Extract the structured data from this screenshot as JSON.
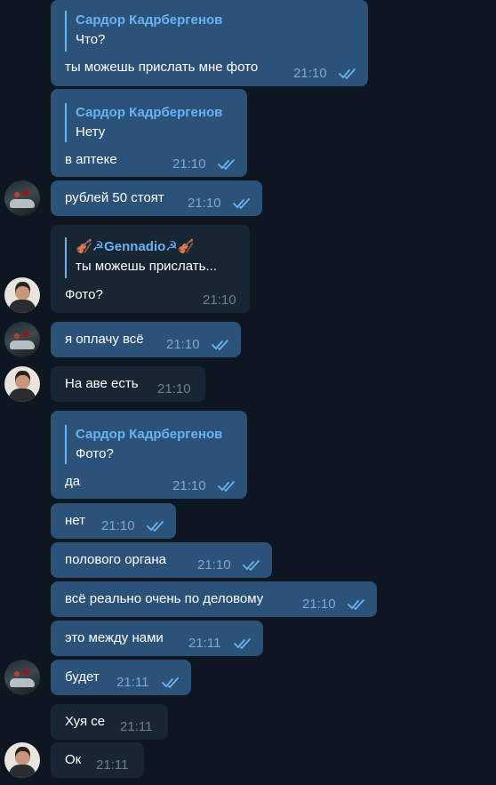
{
  "messages": [
    {
      "quote_name": "Сардор Кадрбергенов",
      "quote_text": "Что?",
      "text": "ты можешь прислать мне фото",
      "time": "21:10"
    },
    {
      "quote_name": "Сардор Кадрбергенов",
      "quote_text": "Нету",
      "text": "в аптеке",
      "time": "21:10"
    },
    {
      "text": "рублей 50 стоят",
      "time": "21:10"
    },
    {
      "quote_name": "🎻☭Gennadio☭🎻",
      "quote_text": "ты можешь прислать...",
      "text": "Фото?",
      "time": "21:10"
    },
    {
      "text": "я оплачу всё",
      "time": "21:10"
    },
    {
      "text": "На аве есть",
      "time": "21:10"
    },
    {
      "quote_name": "Сардор Кадрбергенов",
      "quote_text": "Фото?",
      "text": "да",
      "time": "21:10"
    },
    {
      "text": "нет",
      "time": "21:10"
    },
    {
      "text": "полового органа",
      "time": "21:10"
    },
    {
      "text": "всё реально очень по деловому",
      "time": "21:10"
    },
    {
      "text": "это между нами",
      "time": "21:11"
    },
    {
      "text": "будет",
      "time": "21:11"
    },
    {
      "text": "Хуя се",
      "time": "21:11"
    },
    {
      "text": "Ок",
      "time": "21:11"
    }
  ],
  "avatars": {
    "outgoing": "car-avatar",
    "incoming": "person-avatar"
  },
  "colors": {
    "background": "#0e1621",
    "outgoing_bubble": "#2b5278",
    "incoming_bubble": "#182533",
    "accent": "#6ab3f3",
    "read_checks": "#6ab3f3"
  },
  "icons": {
    "read_status": "double-check-icon"
  }
}
